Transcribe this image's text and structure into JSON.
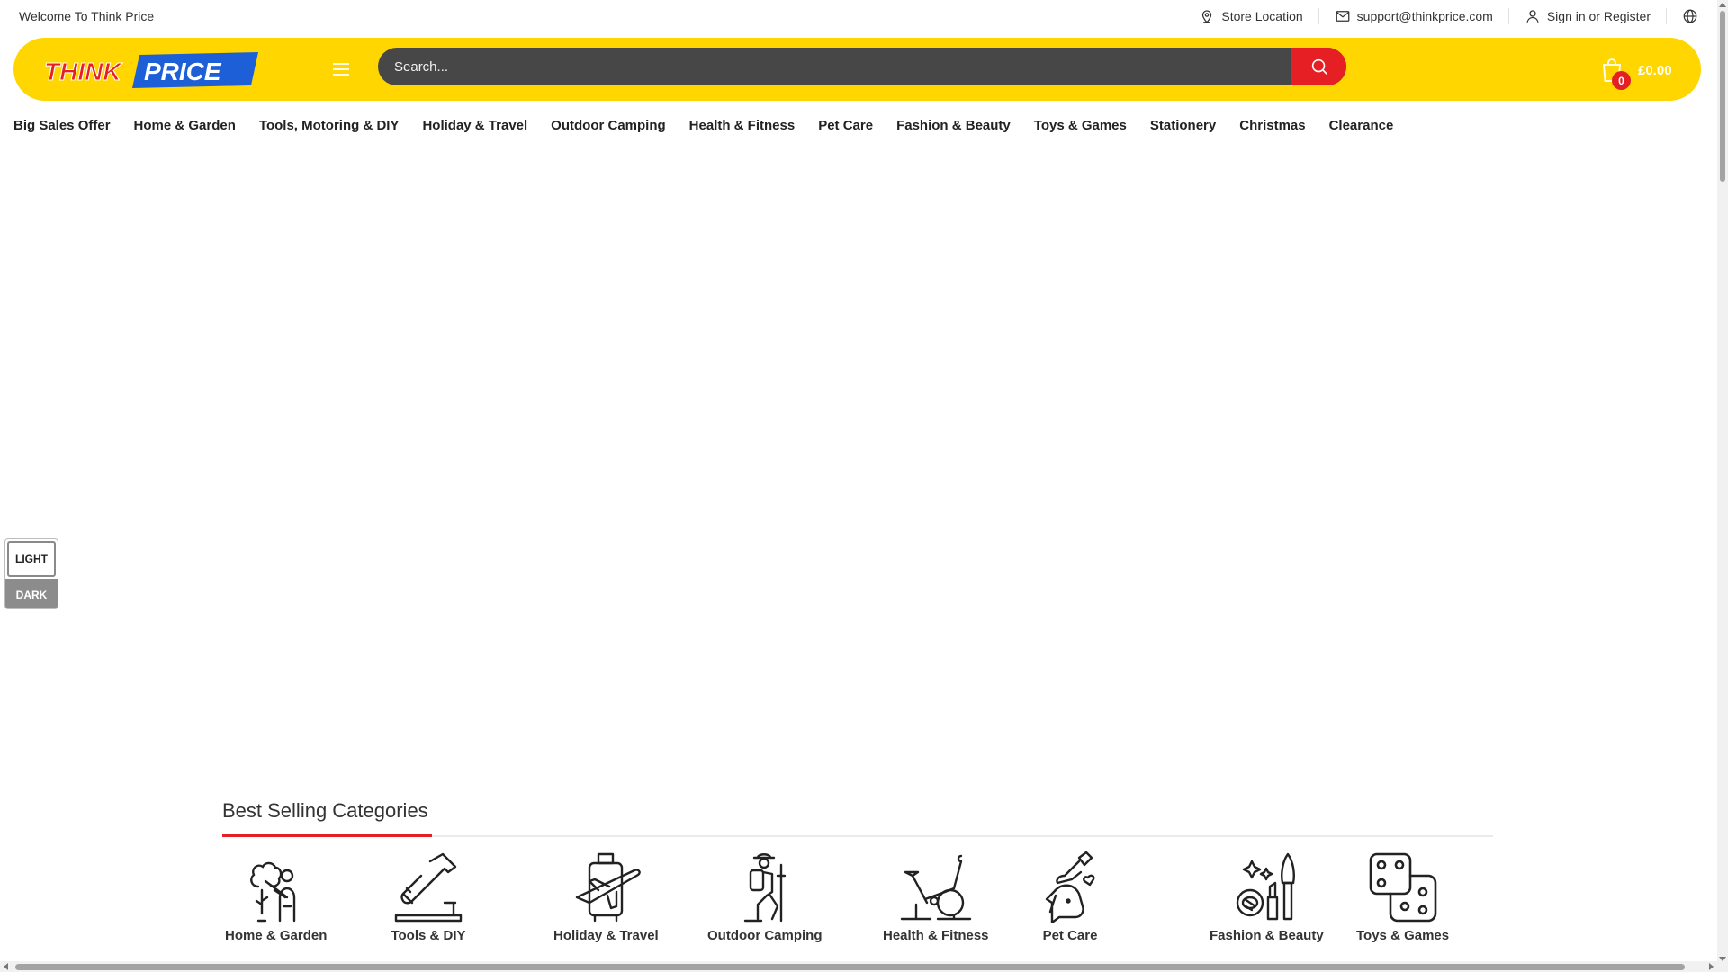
{
  "topbar": {
    "welcome": "Welcome To Think Price",
    "store_location": "Store Location",
    "email": "support@thinkprice.com",
    "sign_in": "Sign in or Register"
  },
  "header": {
    "logo_think": "THINK",
    "logo_price": "PRICE",
    "search_placeholder": "Search...",
    "cart_count": "0",
    "cart_total": "£0.00",
    "colors": {
      "brand_yellow": "#ffd600",
      "accent_red": "#e61f24",
      "logo_blue": "#1d5fd6",
      "search_bg": "#474747"
    }
  },
  "nav": {
    "items": [
      "Big Sales Offer",
      "Home & Garden",
      "Tools, Motoring & DIY",
      "Holiday & Travel",
      "Outdoor Camping",
      "Health & Fitness",
      "Pet Care",
      "Fashion & Beauty",
      "Toys & Games",
      "Stationery",
      "Christmas",
      "Clearance"
    ]
  },
  "theme_toggle": {
    "light": "LIGHT",
    "dark": "DARK"
  },
  "best_selling": {
    "title": "Best Selling Categories",
    "categories": [
      {
        "label": "Home & Garden",
        "icon": "gardener-icon"
      },
      {
        "label": "Tools & DIY",
        "icon": "hammer-icon"
      },
      {
        "label": "Holiday & Travel",
        "icon": "suitcase-plane-icon"
      },
      {
        "label": "Outdoor Camping",
        "icon": "hiker-icon"
      },
      {
        "label": "Health & Fitness",
        "icon": "exercise-bike-icon"
      },
      {
        "label": "Pet Care",
        "icon": "pet-hand-icon"
      },
      {
        "label": "Fashion & Beauty",
        "icon": "makeup-icon"
      },
      {
        "label": "Toys & Games",
        "icon": "dice-icon"
      }
    ]
  }
}
